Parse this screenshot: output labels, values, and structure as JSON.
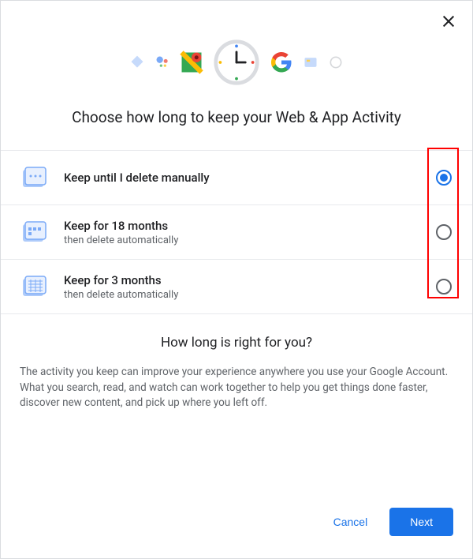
{
  "title": "Choose how long to keep your Web & App Activity",
  "options": [
    {
      "label": "Keep until I delete manually",
      "sublabel": "",
      "selected": true
    },
    {
      "label": "Keep for 18 months",
      "sublabel": "then delete automatically",
      "selected": false
    },
    {
      "label": "Keep for 3 months",
      "sublabel": "then delete automatically",
      "selected": false
    }
  ],
  "info": {
    "title": "How long is right for you?",
    "body": "The activity you keep can improve your experience anywhere you use your Google Account. What you search, read, and watch can work together to help you get things done faster, discover new content, and pick up where you left off."
  },
  "buttons": {
    "cancel": "Cancel",
    "next": "Next"
  }
}
